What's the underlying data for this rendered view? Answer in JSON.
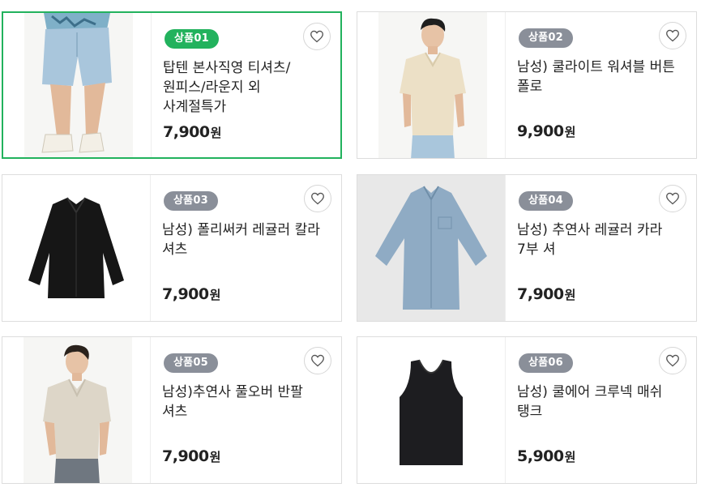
{
  "products": [
    {
      "badge": "상품01",
      "title": "탑텐 본사직영 티셔츠/원피스/라운지 외 사계절특가",
      "price": "7,900",
      "currency": "원",
      "selected": true,
      "image_icon": "shorts-model-image"
    },
    {
      "badge": "상품02",
      "title": "남성) 쿨라이트 워셔블 버튼 폴로",
      "price": "9,900",
      "currency": "원",
      "selected": false,
      "image_icon": "polo-model-image"
    },
    {
      "badge": "상품03",
      "title": "남성) 폴리써커 레귤러 칼라 셔츠",
      "price": "7,900",
      "currency": "원",
      "selected": false,
      "image_icon": "black-shirt-image"
    },
    {
      "badge": "상품04",
      "title": "남성) 추연사 레귤러 카라 7부 셔",
      "price": "7,900",
      "currency": "원",
      "selected": false,
      "image_icon": "blue-shirt-image"
    },
    {
      "badge": "상품05",
      "title": "남성)추연사 풀오버 반팔 셔츠",
      "price": "7,900",
      "currency": "원",
      "selected": false,
      "image_icon": "pullover-model-image"
    },
    {
      "badge": "상품06",
      "title": "남성) 쿨에어 크루넥 매쉬 탱크",
      "price": "5,900",
      "currency": "원",
      "selected": false,
      "image_icon": "tank-top-image"
    }
  ],
  "colors": {
    "accent_green": "#22b25d",
    "badge_grey": "#8a8f99",
    "border": "#dddddd"
  },
  "wishlist_icon": "heart-outline-icon"
}
